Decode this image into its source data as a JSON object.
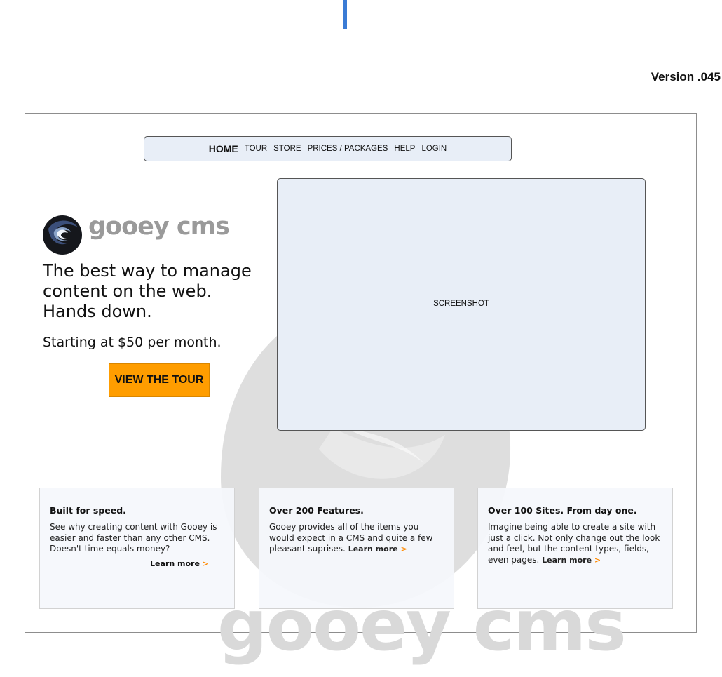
{
  "version": "Version .045",
  "nav": {
    "items": [
      "HOME",
      "TOUR",
      "STORE",
      "PRICES / PACKAGES",
      "HELP",
      "LOGIN"
    ]
  },
  "logo": {
    "wordmark": "gooey cms"
  },
  "hero": {
    "headline": "The best way to manage content on the web. Hands down.",
    "price": "Starting at $50 per month.",
    "cta": "VIEW THE TOUR",
    "screenshot_label": "SCREENSHOT"
  },
  "cards": [
    {
      "title": "Built for speed.",
      "body": "See why creating content with Gooey is easier and faster than any other CMS. Doesn't time equals money?",
      "link": "Learn more",
      "arrow": ">"
    },
    {
      "title": "Over 200 Features.",
      "body": "Gooey provides all of the items you would expect in a CMS and quite a few pleasant suprises.",
      "link": "Learn more",
      "arrow": ">"
    },
    {
      "title": "Over 100 Sites. From day one.",
      "body": "Imagine being able to create a site with just a click. Not only change out the look and feel, but the content types, fields, even pages.",
      "link": "Learn more",
      "arrow": ">"
    }
  ],
  "watermark": {
    "text": "gooey cms"
  },
  "colors": {
    "accent": "#ff9d00",
    "panel": "#e8eef7",
    "cursor": "#3a7bd5"
  }
}
